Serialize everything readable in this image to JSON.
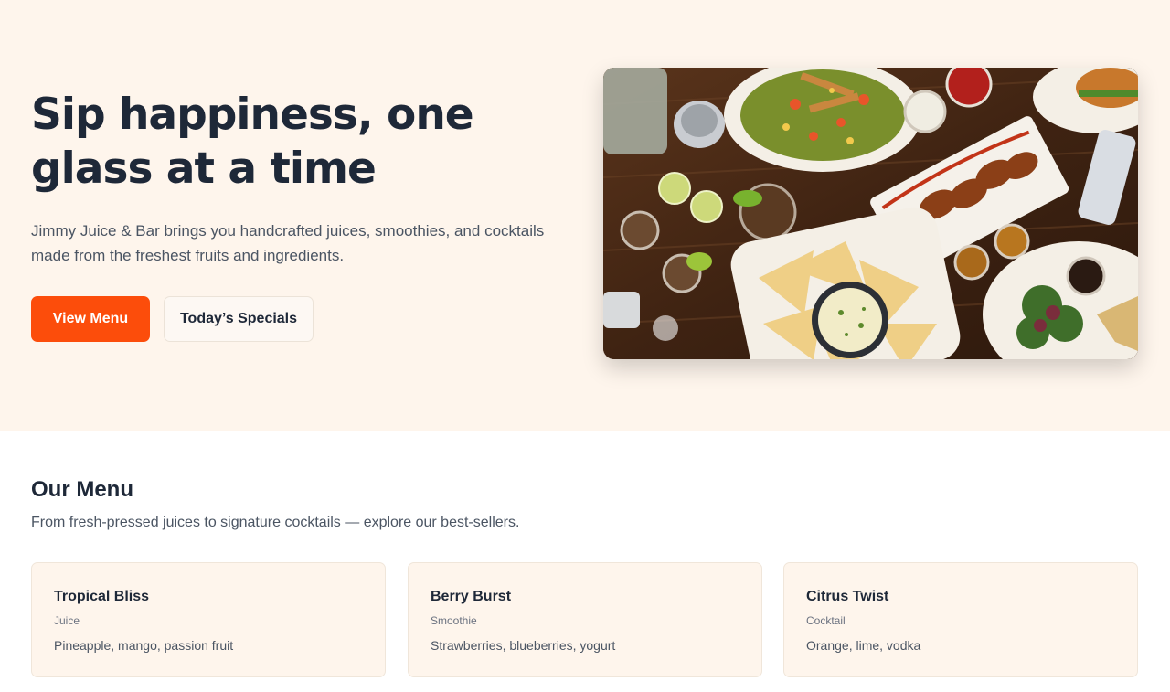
{
  "hero": {
    "title": "Sip happiness, one glass at a time",
    "description": "Jimmy Juice & Bar brings you handcrafted juices, smoothies, and cocktails made from the freshest fruits and ingredients.",
    "primary_button": "View Menu",
    "secondary_button": "Today’s Specials"
  },
  "menu": {
    "title": "Our Menu",
    "subtitle": "From fresh-pressed juices to signature cocktails — explore our best-sellers.",
    "items": [
      {
        "name": "Tropical Bliss",
        "category": "Juice",
        "ingredients": "Pineapple, mango, passion fruit"
      },
      {
        "name": "Berry Burst",
        "category": "Smoothie",
        "ingredients": "Strawberries, blueberries, yogurt"
      },
      {
        "name": "Citrus Twist",
        "category": "Cocktail",
        "ingredients": "Orange, lime, vodka"
      }
    ]
  },
  "colors": {
    "hero_background": "#fef5ec",
    "primary_accent": "#fc4d0b",
    "heading": "#1e2838",
    "body_text": "#4b5563"
  }
}
